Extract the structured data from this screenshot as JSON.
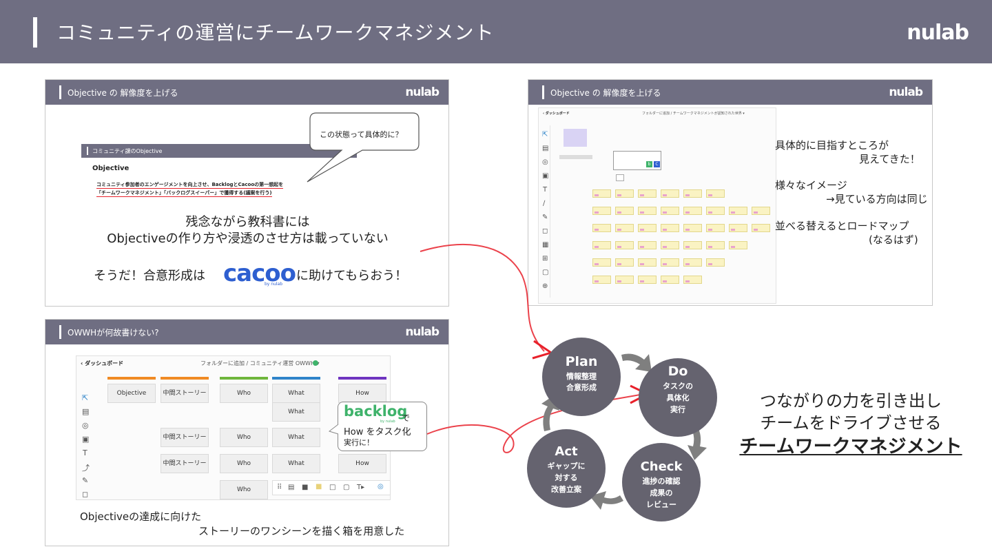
{
  "header": {
    "title": "コミュニティの運営にチームワークマネジメント",
    "logo": "nulab"
  },
  "panel1": {
    "title": "Objective の 解像度を上げる",
    "logo": "nulab",
    "inner_title": "コミュニティ課のObjective",
    "objective_heading": "Objective",
    "objective_line1": "コミュニティ参加者のエンゲージメントを向上させ、BacklogとCacooの第一想起を",
    "objective_line2": "「チームワークマネジメント」「バックログスイーパー」で獲得する(議案を行う)",
    "bubble": "この状態って具体的に？",
    "text1": "残念ながら教科書には",
    "text2": "Objectiveの作り方や浸透のさせ方は載っていない",
    "text3a": "そうだ！合意形成は",
    "text3b": "に助けてもらおう！",
    "cacoo_logo": "cacoo",
    "cacoo_by": "by nulab"
  },
  "panel2": {
    "title": "Objective の 解像度を上げる",
    "logo": "nulab",
    "breadcrumb": "‹ ダッシュボード",
    "folder": "フォルダーに追加 / チームワークマネジメントが認知された世界 ▾",
    "note1a": "具体的に目指すところが",
    "note1b": "見えてきた！",
    "note2a": "様々なイメージ",
    "note2b": "→見ている方向は同じ",
    "note3a": "並べる替えるとロードマップ",
    "note3b": "(なるはず)",
    "icon_b": "b",
    "icon_c": "C"
  },
  "panel3": {
    "title": "OWWHが何故書けない?",
    "logo": "nulab",
    "breadcrumb": "‹ ダッシュボード",
    "folder": "フォルダーに追加 / コミュニティ運営 OWWH ▾",
    "columns": [
      "Objective",
      "中間ストーリー",
      "Who",
      "What",
      "How"
    ],
    "column_colors": [
      "#f08a24",
      "#f08a24",
      "#6fb63c",
      "#2f84c9",
      "#6f35c0"
    ],
    "rows": [
      {
        "objective": "Objective",
        "story": "中間ストーリー",
        "who": "Who",
        "what": "What",
        "how": "How"
      },
      {
        "what": "What"
      },
      {
        "story": "中間ストーリー",
        "who": "Who",
        "what": "What"
      },
      {
        "story": "中間ストーリー",
        "who": "Who",
        "what": "What",
        "how": "How"
      },
      {
        "who": "Who"
      }
    ],
    "backlog_logo": "backlog",
    "backlog_by": "by nulab",
    "backlog_de": "で",
    "backlog_line1": "How をタスク化",
    "backlog_line2": "実行に！",
    "caption1": "Objectiveの達成に向けた",
    "caption2": "ストーリーのワンシーンを描く箱を用意した"
  },
  "cycle": {
    "plan": {
      "title": "Plan",
      "line1": "情報整理",
      "line2": "合意形成"
    },
    "do": {
      "title": "Do",
      "line1": "タスクの",
      "line2": "具体化",
      "line3": "実行"
    },
    "check": {
      "title": "Check",
      "line1": "進捗の確認",
      "line2": "成果の",
      "line3": "レビュー"
    },
    "act": {
      "title": "Act",
      "line1": "ギャップに",
      "line2": "対する",
      "line3": "改善立案"
    },
    "circle_color": "#65636f",
    "arrow_color": "#7f7f7f"
  },
  "tagline": {
    "line1": "つながりの力を引き出し",
    "line2": "チームをドライブさせる",
    "line3": "チームワークマネジメント"
  },
  "colors": {
    "header": "#6f6e82",
    "accent_red": "#e8212b",
    "cacoo_blue": "#2e5fd0",
    "backlog_green": "#3fb36b"
  }
}
